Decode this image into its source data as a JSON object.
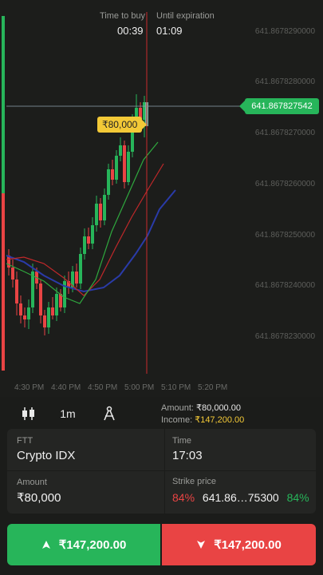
{
  "header": {
    "time_to_buy_label": "Time to buy",
    "time_to_buy_value": "00:39",
    "until_expiration_label": "Until expiration",
    "until_expiration_value": "01:09"
  },
  "chart_data": {
    "type": "candlestick",
    "y_ticks": [
      "641.8678290000",
      "641.8678280000",
      "641.8678270000",
      "641.8678260000",
      "641.8678250000",
      "641.8678240000",
      "641.8678230000"
    ],
    "x_ticks": [
      "4:30 PM",
      "4:40 PM",
      "4:50 PM",
      "5:00 PM",
      "5:10 PM",
      "5:20 PM"
    ],
    "current_price": "641.867827542",
    "trade_amount_marker": "₹80,000",
    "colors": {
      "up": "#27b55a",
      "down": "#e94444",
      "ma_fast": "#2fa83e",
      "ma_mid": "#c0282a",
      "ma_slow": "#2a3ba8",
      "expiry_line": "#c92c2c"
    }
  },
  "toolbar": {
    "candles_icon": "candlestick-icon",
    "interval": "1m",
    "drawing_icon": "compass-icon",
    "amount_label": "Amount:",
    "amount_value": "₹80,000.00",
    "income_label": "Income:",
    "income_value": "₹147,200.00"
  },
  "panel": {
    "asset_label": "FTT",
    "asset_value": "Crypto IDX",
    "time_label": "Time",
    "time_value": "17:03",
    "amount_label": "Amount",
    "amount_value": "₹80,000",
    "strike_label": "Strike price",
    "strike_left_pct": "84%",
    "strike_value": "641.86…75300",
    "strike_right_pct": "84%"
  },
  "actions": {
    "buy_label": "₹147,200.00",
    "sell_label": "₹147,200.00"
  }
}
